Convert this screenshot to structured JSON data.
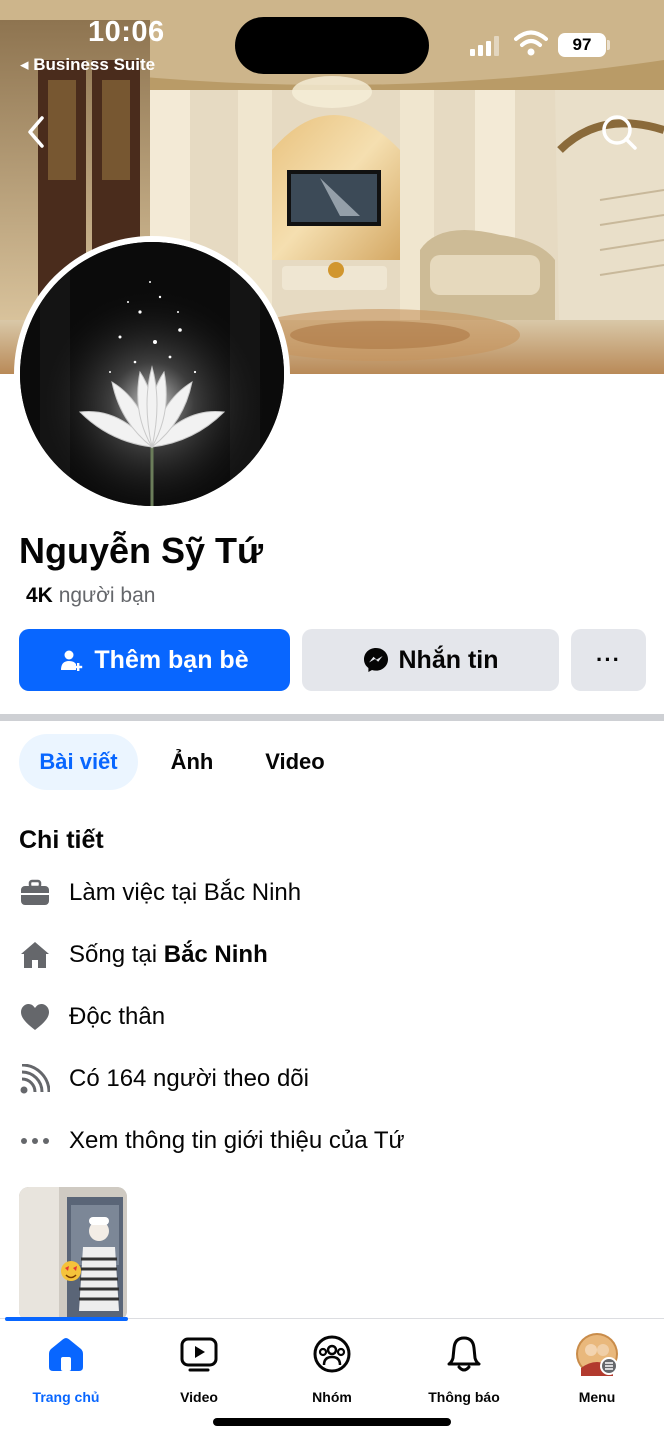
{
  "status_bar": {
    "time": "10:06",
    "back_app": "◂ Business Suite",
    "battery": "97"
  },
  "profile": {
    "name": "Nguyễn Sỹ Tứ",
    "friends_count": "4K",
    "friends_label": "người bạn"
  },
  "actions": {
    "add_friend": "Thêm bạn bè",
    "message": "Nhắn tin",
    "more": "···"
  },
  "tabs": [
    {
      "label": "Bài viết",
      "active": true
    },
    {
      "label": "Ảnh",
      "active": false
    },
    {
      "label": "Video",
      "active": false
    }
  ],
  "details": {
    "title": "Chi tiết",
    "work": "Làm việc tại Bắc Ninh",
    "lives_prefix": "Sống tại ",
    "lives_place": "Bắc Ninh",
    "relationship": "Độc thân",
    "followers": "Có 164 người theo dõi",
    "see_about": "Xem thông tin giới thiệu của Tứ"
  },
  "bottom_nav": [
    {
      "label": "Trang chủ",
      "icon": "home-icon",
      "active": true
    },
    {
      "label": "Video",
      "icon": "video-icon",
      "active": false
    },
    {
      "label": "Nhóm",
      "icon": "groups-icon",
      "active": false
    },
    {
      "label": "Thông báo",
      "icon": "bell-icon",
      "active": false
    },
    {
      "label": "Menu",
      "icon": "menu-avatar",
      "active": false
    }
  ],
  "colors": {
    "accent": "#0866ff",
    "secondary_button": "#e4e6eb",
    "muted_text": "#65676b",
    "active_tab_bg": "#ebf5ff"
  }
}
